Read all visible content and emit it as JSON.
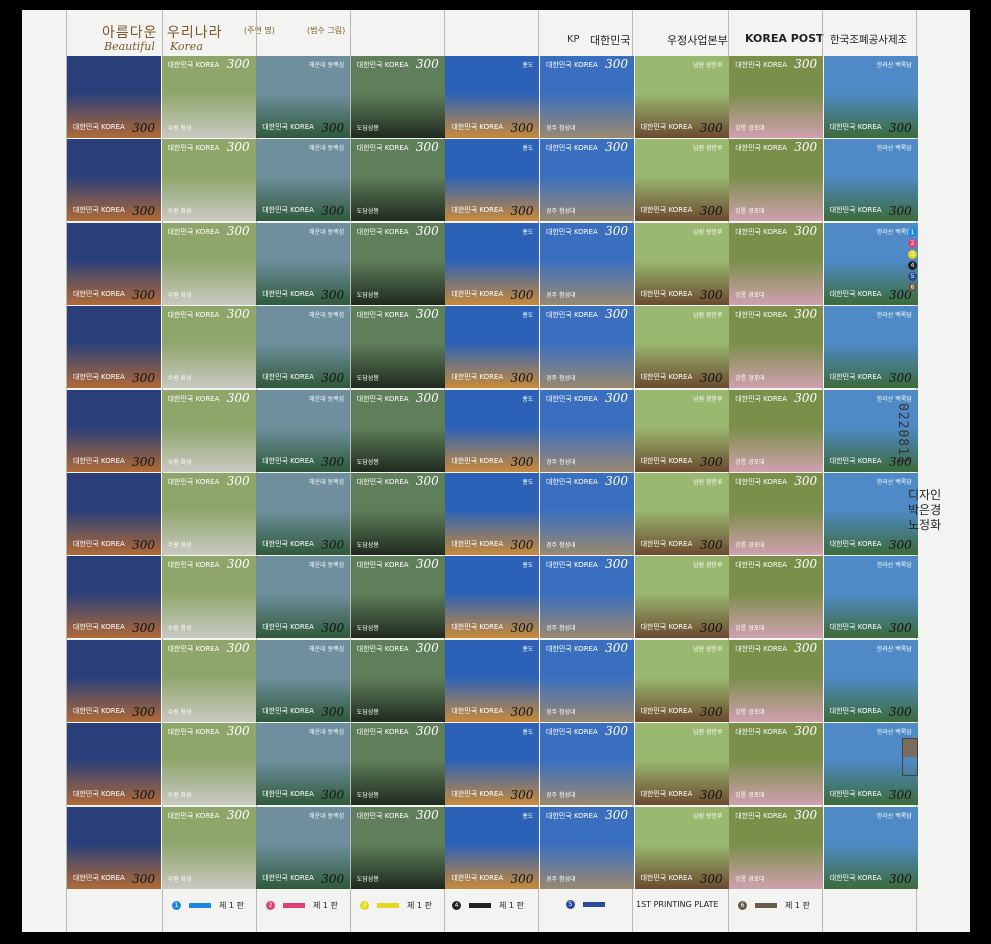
{
  "header": {
    "title_ko_1": "아름다운",
    "title_ko_2": "우리나라",
    "title_sub_1": "(주현 명)",
    "title_sub_2": "(범수 그림)",
    "title_en_1": "Beautiful",
    "title_en_2": "Korea",
    "post_logo": "KP",
    "post_name": "대한민국",
    "post_dept": "우정사업본부",
    "korea_post": "KOREA POST",
    "printer": "한국조폐공사제조"
  },
  "stamp_common": {
    "korea_label": "대한민국 KOREA",
    "value": "300"
  },
  "stamps": [
    {
      "caption": "",
      "colors": [
        "#2a3f7a",
        "#b06a36"
      ]
    },
    {
      "caption": "수원 화성",
      "colors": [
        "#8fa66b",
        "#c9c9c2"
      ]
    },
    {
      "caption": "해운대 동백섬",
      "colors": [
        "#6f8f9e",
        "#2f5a3a"
      ]
    },
    {
      "caption": "도담삼봉",
      "colors": [
        "#5f7f5a",
        "#1f2a1f"
      ]
    },
    {
      "caption": "홍도",
      "colors": [
        "#2b62b8",
        "#c98a3a"
      ]
    },
    {
      "caption": "경주 첨성대",
      "colors": [
        "#3a6fc0",
        "#9a8870"
      ]
    },
    {
      "caption": "남원 광한루",
      "colors": [
        "#9ab870",
        "#6b4a2f"
      ]
    },
    {
      "caption": "강릉 경포대",
      "colors": [
        "#7a8f4a",
        "#d0a0b0"
      ]
    },
    {
      "caption": "한라산 백록담",
      "colors": [
        "#4f8ac6",
        "#3c6b3a"
      ]
    }
  ],
  "rows": 10,
  "side": {
    "color_dots": [
      {
        "n": "1",
        "color": "#1e88e5"
      },
      {
        "n": "2",
        "color": "#e0407a"
      },
      {
        "n": "3",
        "color": "#e6d620"
      },
      {
        "n": "4",
        "color": "#222222"
      },
      {
        "n": "5",
        "color": "#2a4a9a"
      },
      {
        "n": "6",
        "color": "#6b5a48"
      }
    ],
    "serial": "0220811",
    "designer_title": "디자인",
    "designer_1": "박은경",
    "designer_2": "노정화"
  },
  "footer": [
    {
      "n": "1",
      "color": "#1e88e5",
      "label": "제 1 판"
    },
    {
      "n": "2",
      "color": "#e0407a",
      "label": "제 1 판"
    },
    {
      "n": "3",
      "color": "#e6d620",
      "label": "제 1 판"
    },
    {
      "n": "4",
      "color": "#222222",
      "label": "제 1 판"
    },
    {
      "n": "5",
      "color": "#2a4a9a",
      "label": ""
    },
    {
      "n": "",
      "color": "",
      "label": "1ST PRINTING PLATE"
    },
    {
      "n": "6",
      "color": "#6b5a48",
      "label": "제 1 판"
    }
  ]
}
